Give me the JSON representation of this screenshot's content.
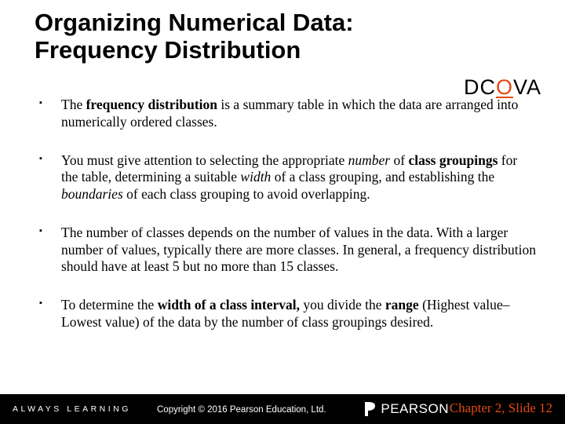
{
  "title": {
    "line1": "Organizing Numerical Data:",
    "line2": "Frequency Distribution"
  },
  "dcova": {
    "d": "D",
    "c": "C",
    "o": "O",
    "v": "V",
    "a": "A"
  },
  "bullets": {
    "b1": {
      "t1": "The ",
      "t2": "frequency distribution",
      "t3": " is a summary table in which the data are arranged into numerically ordered classes."
    },
    "b2": {
      "t1": "You must give attention to selecting the appropriate ",
      "t2": "number",
      "t3": " of ",
      "t4": "class groupings",
      "t5": " for the table, determining a suitable ",
      "t6": "width",
      "t7": " of a class grouping, and establishing the ",
      "t8": "boundaries",
      "t9": " of each class grouping to avoid overlapping."
    },
    "b3": {
      "t1": "The number of classes depends on the number of values in the data.  With a larger number of values, typically there are more classes.  In general, a frequency distribution should have at least 5 but no more than 15 classes."
    },
    "b4": {
      "t1": "To determine the ",
      "t2": "width of a class interval, ",
      "t3": "you divide the ",
      "t4": "range ",
      "t5": "(Highest value–Lowest value) of the data by the number of class groupings desired."
    }
  },
  "footer": {
    "always": "ALWAYS LEARNING",
    "copyright": "Copyright © 2016 Pearson Education, Ltd.",
    "brand": "PEARSON",
    "page": "Chapter 2, Slide 12"
  }
}
